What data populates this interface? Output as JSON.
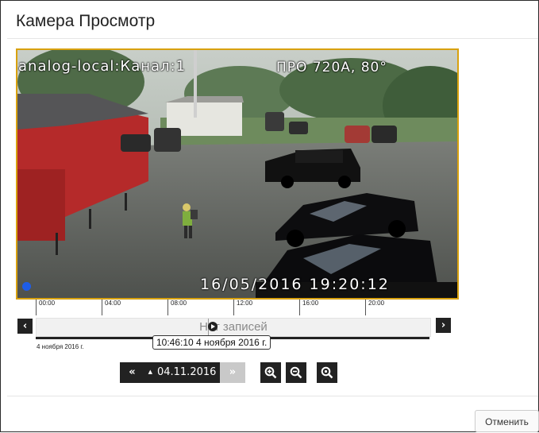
{
  "dialog": {
    "title": "Камера Просмотр",
    "cancel_label": "Отменить"
  },
  "video": {
    "channel_overlay": "analog-local:Канал:1",
    "camera_overlay": "ПРО 720А, 80°",
    "timestamp_overlay": "16/05/2016 19:20:12",
    "border_color": "#d8a10f",
    "live_indicator_color": "#1e5de8"
  },
  "timeline": {
    "ticks": [
      "00:00",
      "04:00",
      "08:00",
      "12:00",
      "16:00",
      "20:00"
    ],
    "prev_icon": "chevron-left-icon",
    "next_icon": "chevron-right-icon",
    "status_text": "Нет записей",
    "day_label": "4 ноября 2016 г.",
    "cursor_tooltip": "10:46:10 4 ноября 2016 г."
  },
  "date_control": {
    "prev_label": "«",
    "date_value": "04.11.2016",
    "next_label": "»"
  },
  "zoom": {
    "zoom_in_icon": "zoom-in-icon",
    "zoom_out_icon": "zoom-out-icon",
    "zoom_reset_icon": "zoom-reset-icon"
  }
}
